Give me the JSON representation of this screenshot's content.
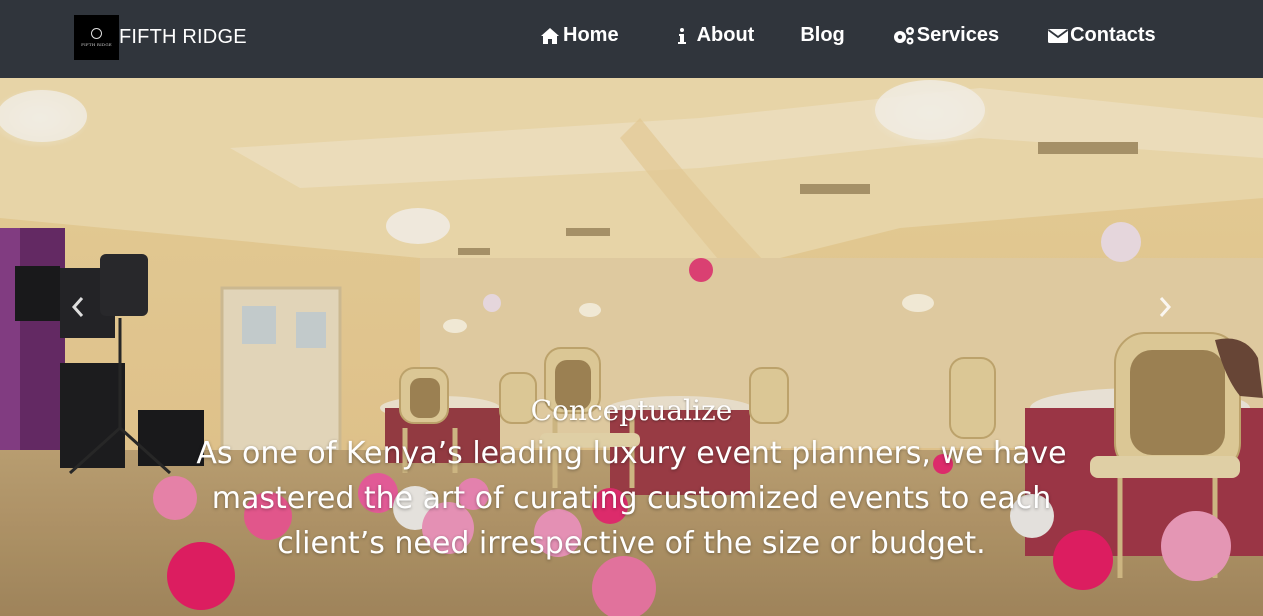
{
  "brand": {
    "name": "FIFTH RIDGE",
    "logo_text": "FIFTH RIDGE"
  },
  "nav": {
    "home": "Home",
    "about": "About",
    "blog": "Blog",
    "services": "Services",
    "contacts": "Contacts"
  },
  "icons": {
    "home": "home-icon",
    "about": "info-icon",
    "services": "gears-icon",
    "contacts": "envelope-icon",
    "prev": "chevron-left-icon",
    "next": "chevron-right-icon"
  },
  "carousel": {
    "title": "Conceptualize",
    "text": "As one of Kenya’s leading luxury event planners, we have mastered the art of curating customized events to each client’s need irrespective of the size or budget."
  },
  "colors": {
    "navbar": "#30353c",
    "text": "#ffffff"
  }
}
